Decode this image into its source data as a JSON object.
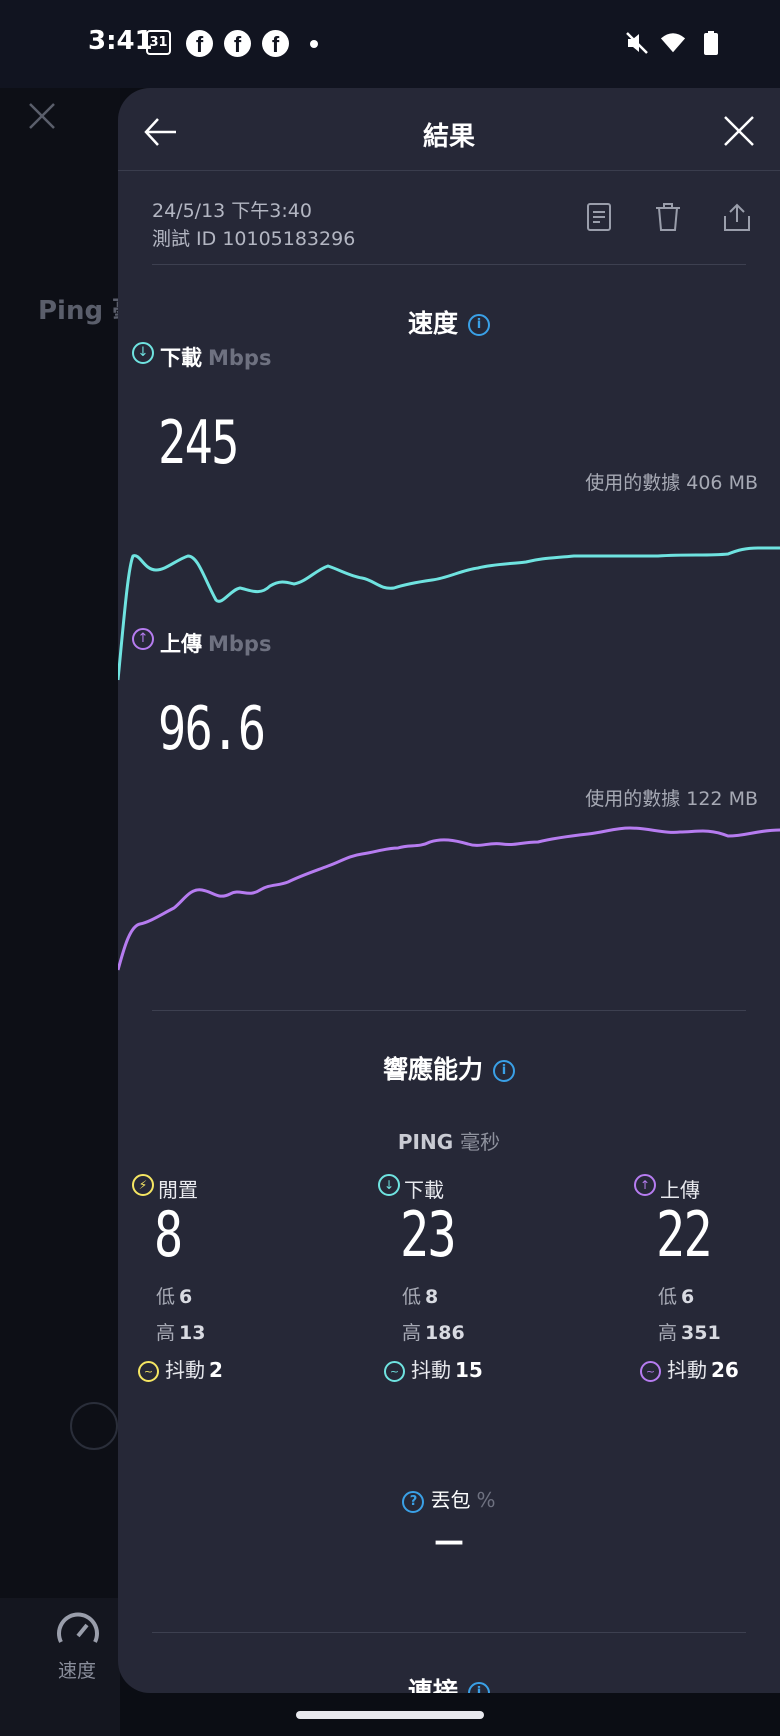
{
  "status_bar": {
    "time": "3:41",
    "calendar_day": "31",
    "fb_letter": "f"
  },
  "background_app": {
    "ping_label": "Ping 毫",
    "nav_label": "速度"
  },
  "header": {
    "title": "結果"
  },
  "meta": {
    "date": "24/5/13 下午3:40",
    "test_id": "測試 ID 10105183296"
  },
  "speed": {
    "title": "速度",
    "download": {
      "label": "下載",
      "unit": "Mbps",
      "value": "245",
      "data_used": "使用的數據 406 MB"
    },
    "upload": {
      "label": "上傳",
      "unit": "Mbps",
      "value": "96.6",
      "data_used": "使用的數據 122 MB"
    }
  },
  "responsiveness": {
    "title": "響應能力",
    "ping_label": "PING",
    "ping_unit": "毫秒",
    "columns": [
      {
        "label": "閒置",
        "value": "8",
        "low_label": "低",
        "low": "6",
        "high_label": "高",
        "high": "13",
        "jitter_label": "抖動",
        "jitter": "2",
        "color": "#f5e663"
      },
      {
        "label": "下載",
        "value": "23",
        "low_label": "低",
        "low": "8",
        "high_label": "高",
        "high": "186",
        "jitter_label": "抖動",
        "jitter": "15",
        "color": "#6fe3e0"
      },
      {
        "label": "上傳",
        "value": "22",
        "low_label": "低",
        "low": "6",
        "high_label": "高",
        "high": "351",
        "jitter_label": "抖動",
        "jitter": "26",
        "color": "#b67cf0"
      }
    ]
  },
  "packet_loss": {
    "label": "丟包",
    "unit": "%",
    "value": "—"
  },
  "connection": {
    "title": "連接"
  },
  "colors": {
    "download": "#6fe3e0",
    "upload": "#b67cf0",
    "info": "#3aa0e6",
    "sheet": "#262837"
  }
}
